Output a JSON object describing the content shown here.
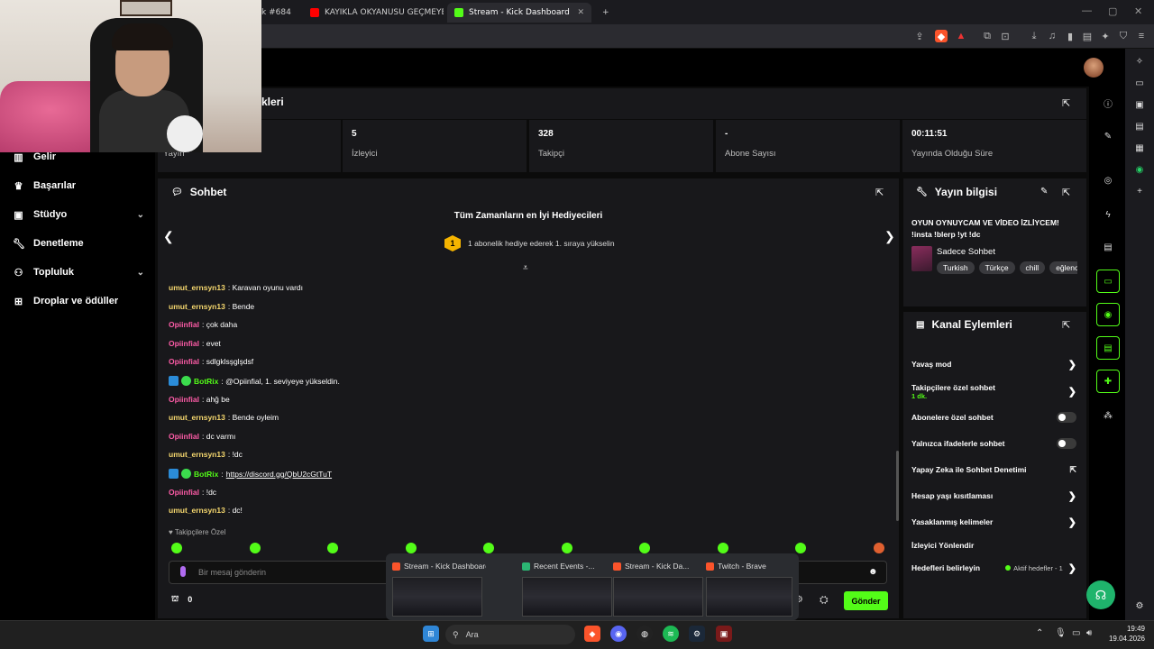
{
  "browser": {
    "tabs": [
      {
        "title": "k #684"
      },
      {
        "title": "KAYIKLA OKYANUSU GEÇMEYE ÇALI"
      },
      {
        "title": "Stream - Kick Dashboard"
      }
    ],
    "new_tab": "+"
  },
  "nav": {
    "items": [
      {
        "label": "Gelir",
        "icon": "chart-icon"
      },
      {
        "label": "Başarılar",
        "icon": "trophy-icon"
      },
      {
        "label": "Stüdyo",
        "icon": "studio-icon",
        "expandable": true
      },
      {
        "label": "Denetleme",
        "icon": "wrench-icon"
      },
      {
        "label": "Topluluk",
        "icon": "people-icon",
        "expandable": true
      },
      {
        "label": "Droplar ve ödüller",
        "icon": "gift-icon"
      }
    ]
  },
  "stats": {
    "title": "kleri",
    "items": [
      {
        "value": "",
        "label": "Yayın"
      },
      {
        "value": "5",
        "label": "İzleyici"
      },
      {
        "value": "328",
        "label": "Takipçi"
      },
      {
        "value": "-",
        "label": "Abone Sayısı"
      },
      {
        "value": "00:11:51",
        "label": "Yayında Olduğu Süre"
      }
    ]
  },
  "chat": {
    "title": "Sohbet",
    "gifters_title": "Tüm Zamanların en İyi Hediyecileri",
    "gifters_badge": "1",
    "gifters_sub": "1 abonelik hediye ederek 1. sıraya yükselin",
    "messages": [
      {
        "user": "umut_ernsyn13",
        "text": ": Karavan oyunu vardı",
        "color": "#f5d76e"
      },
      {
        "user": "umut_ernsyn13",
        "text": ": Bende",
        "color": "#f5d76e"
      },
      {
        "user": "Opiinfial",
        "text": ": çok daha",
        "color": "#ff5ca8"
      },
      {
        "user": "Opiinfial",
        "text": ": evet",
        "color": "#ff5ca8"
      },
      {
        "user": "Opiinfial",
        "text": ": sdlgklsşglşdsf",
        "color": "#ff5ca8"
      },
      {
        "user": "BotRix",
        "text": ": @Opiinfial, 1. seviyeye yükseldin.",
        "color": "#53fc18",
        "bot": true
      },
      {
        "user": "Opiinfial",
        "text": ": ahğ be",
        "color": "#ff5ca8"
      },
      {
        "user": "umut_ernsyn13",
        "text": ": Bende oyleim",
        "color": "#f5d76e"
      },
      {
        "user": "Opiinfial",
        "text": ": dc varmı",
        "color": "#ff5ca8"
      },
      {
        "user": "umut_ernsyn13",
        "text": ": !dc",
        "color": "#f5d76e"
      },
      {
        "user": "BotRix",
        "text": ": ",
        "link": "https://discord.gg/QbU2cGtTuT",
        "color": "#53fc18",
        "bot": true
      },
      {
        "user": "Opiinfial",
        "text": ": !dc",
        "color": "#ff5ca8"
      },
      {
        "user": "umut_ernsyn13",
        "text": ": dc!",
        "color": "#f5d76e"
      }
    ],
    "followers_only": "Takipçilere Özel",
    "input_placeholder": "Bir mesaj gönderin",
    "points": "0",
    "send_label": "Gönder"
  },
  "stream_info": {
    "title": "Yayın bilgisi",
    "description": "OYUN OYNUYCAM VE VİDEO İZLİYCEM! !insta !blerp !yt !dc",
    "category": "Sadece Sohbet",
    "tags": [
      "Turkish",
      "Türkçe",
      "chill",
      "eğlence"
    ]
  },
  "channel_actions": {
    "title": "Kanal Eylemleri",
    "items": [
      {
        "label": "Yavaş mod",
        "control": "chevron"
      },
      {
        "label": "Takipçilere özel sohbet",
        "sub": "1 dk.",
        "control": "chevron"
      },
      {
        "label": "Abonelere özel sohbet",
        "control": "toggle"
      },
      {
        "label": "Yalnızca ifadelerle sohbet",
        "control": "toggle"
      },
      {
        "label": "Yapay Zeka ile Sohbet Denetimi",
        "control": "external"
      },
      {
        "label": "Hesap yaşı kısıtlaması",
        "control": "chevron"
      },
      {
        "label": "Yasaklanmış kelimeler",
        "control": "chevron"
      },
      {
        "label": "İzleyici Yönlendir",
        "control": "none"
      },
      {
        "label": "Hedefleri belirleyin",
        "note": "Aktif hedefler - 1",
        "control": "chevron"
      }
    ]
  },
  "taskbar_preview": {
    "items": [
      "Stream - Kick Dashboard -...",
      "Recent Events -...",
      "Stream - Kick Da...",
      "Twitch - Brave"
    ]
  },
  "taskbar": {
    "search_placeholder": "Ara",
    "time": "19:49",
    "date": "19.04.2026"
  },
  "colors": {
    "accent": "#53fc18",
    "panel": "#18181b",
    "background": "#0b0b0b"
  }
}
